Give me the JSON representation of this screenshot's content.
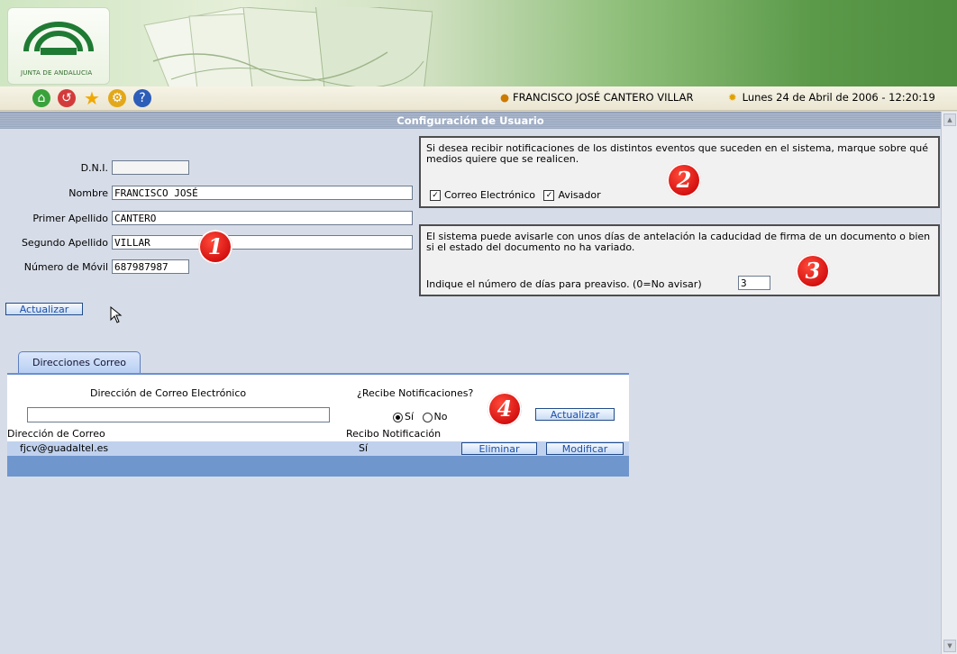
{
  "header": {
    "logo_text": "JUNTA DE ANDALUCIA",
    "user_name": "FRANCISCO JOSÉ CANTERO VILLAR",
    "date_text": "Lunes 24 de Abril de 2006 - 12:20:19",
    "toolbar_icons": [
      "home-icon",
      "back-icon",
      "favorites-icon",
      "settings-icon",
      "help-icon"
    ]
  },
  "page_title": "Configuración de Usuario",
  "user_form": {
    "dni_label": "D.N.I.",
    "dni_value": "",
    "nombre_label": "Nombre",
    "nombre_value": "FRANCISCO JOSÉ",
    "apellido1_label": "Primer Apellido",
    "apellido1_value": "CANTERO",
    "apellido2_label": "Segundo Apellido",
    "apellido2_value": "VILLAR",
    "movil_label": "Número de Móvil",
    "movil_value": "687987987",
    "update_button": "Actualizar"
  },
  "notifications_box": {
    "text": "Si desea recibir notificaciones de los distintos eventos que suceden en el sistema, marque sobre qué medios quiere que se realicen.",
    "email_label": "Correo Electrónico",
    "email_checked": true,
    "avisador_label": "Avisador",
    "avisador_checked": true
  },
  "expiry_box": {
    "text": "El sistema puede avisarle con unos días de antelación la caducidad de firma de un documento o bien si el estado del documento no ha variado.",
    "days_label": "Indique el número de días para preaviso. (0=No avisar)",
    "days_value": "3"
  },
  "markers": [
    "1",
    "2",
    "3",
    "4"
  ],
  "email_tab": {
    "tab_label": "Direcciones Correo",
    "address_header": "Dirección de Correo Electrónico",
    "notify_header": "¿Recibe Notificaciones?",
    "new_address_value": "",
    "radio_yes": "Sí",
    "radio_no": "No",
    "radio_selected": "Sí",
    "add_button": "Actualizar",
    "table": {
      "columns": [
        "Dirección de Correo",
        "Recibo Notificación"
      ],
      "rows": [
        {
          "address": "fjcv@guadaltel.es",
          "notify": "Sí",
          "delete": "Eliminar",
          "edit": "Modificar"
        }
      ]
    }
  },
  "colors": {
    "accent_blue": "#6f96cd",
    "title_bar": "#9aa8bf",
    "marker_red": "#d10d0d"
  }
}
